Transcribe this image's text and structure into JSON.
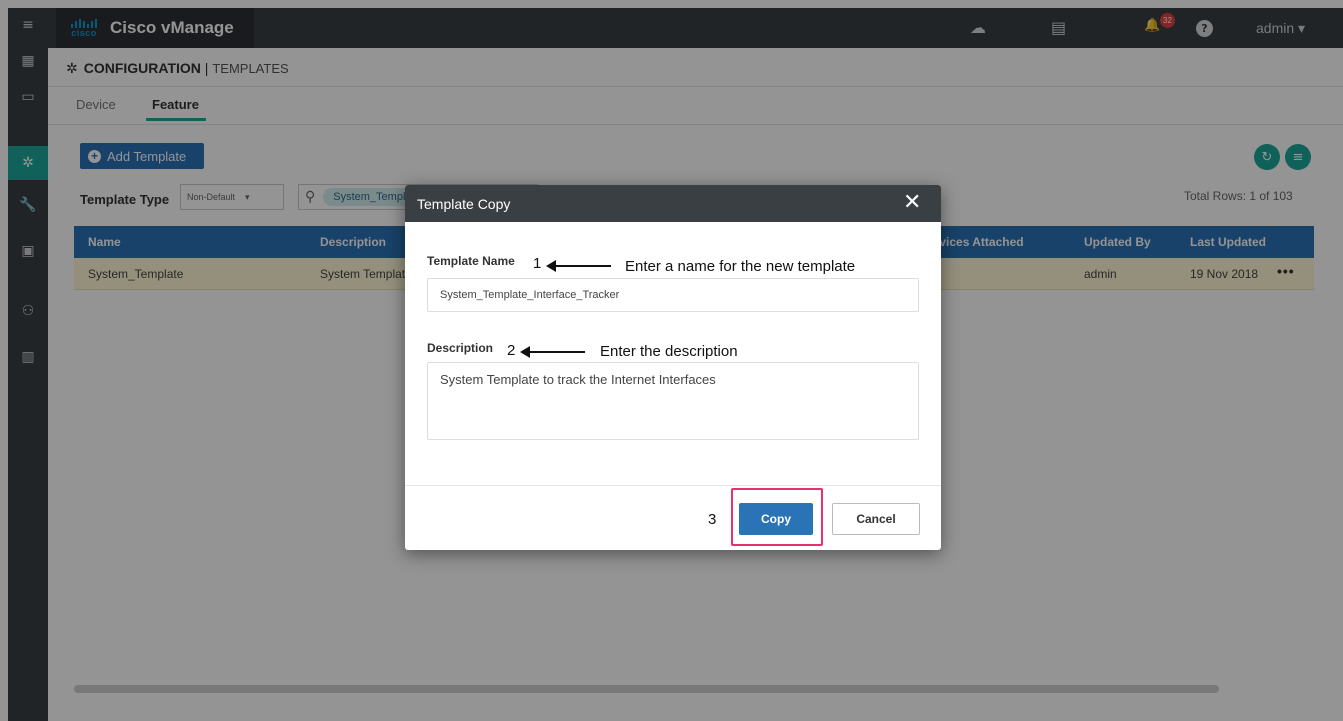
{
  "app": {
    "title": "Cisco vManage",
    "logo_text": "cisco",
    "user_menu": "admin ▾",
    "notification_count": "32"
  },
  "sidebar": {
    "items": [
      {
        "icon": "menu-icon",
        "glyph": "≡"
      },
      {
        "icon": "dashboard-icon",
        "glyph": "▦"
      },
      {
        "icon": "monitor-icon",
        "glyph": "▭"
      },
      {
        "icon": "configuration-gear-icon",
        "glyph": "✲"
      },
      {
        "icon": "tools-wrench-icon",
        "glyph": "🔧"
      },
      {
        "icon": "maintenance-toolbox-icon",
        "glyph": "▣"
      },
      {
        "icon": "administration-users-icon",
        "glyph": "⚇"
      },
      {
        "icon": "analytics-chart-icon",
        "glyph": "▥"
      }
    ]
  },
  "header": {
    "icons": {
      "cloud": "☁",
      "tasks": "▤",
      "bell": "🔔",
      "help": "?"
    }
  },
  "breadcrumb": {
    "section": "CONFIGURATION",
    "separator": " | ",
    "page": "TEMPLATES"
  },
  "tabs": [
    {
      "label": "Device",
      "active": false
    },
    {
      "label": "Feature",
      "active": true
    }
  ],
  "toolbar": {
    "add_label": "Add Template",
    "template_type_label": "Template Type",
    "template_type_value": "Non-Default",
    "search_chip": "System_Template",
    "total_rows": "Total Rows: 1 of 103"
  },
  "table": {
    "columns": [
      "Name",
      "Description",
      "Devices Attached",
      "Updated By",
      "Last Updated"
    ],
    "row": [
      "System_Template",
      "System Template",
      "",
      "admin",
      "19 Nov 2018"
    ],
    "more": "•••"
  },
  "modal": {
    "title": "Template Copy",
    "name_label": "Template Name",
    "name_value": "System_Template_Interface_Tracker",
    "desc_label": "Description",
    "desc_value": "System Template to track the Internet Interfaces",
    "copy_label": "Copy",
    "cancel_label": "Cancel"
  },
  "annotations": {
    "step1_num": "1",
    "step1_text": "Enter a name for the new template",
    "step2_num": "2",
    "step2_text": "Enter the description",
    "step3_num": "3"
  },
  "colors": {
    "accent_teal": "#1aa89b",
    "primary_blue": "#2a73b6",
    "dark_bar": "#3a3f44",
    "highlight_pink": "#e5316e",
    "row_selected": "#fff8d6"
  }
}
